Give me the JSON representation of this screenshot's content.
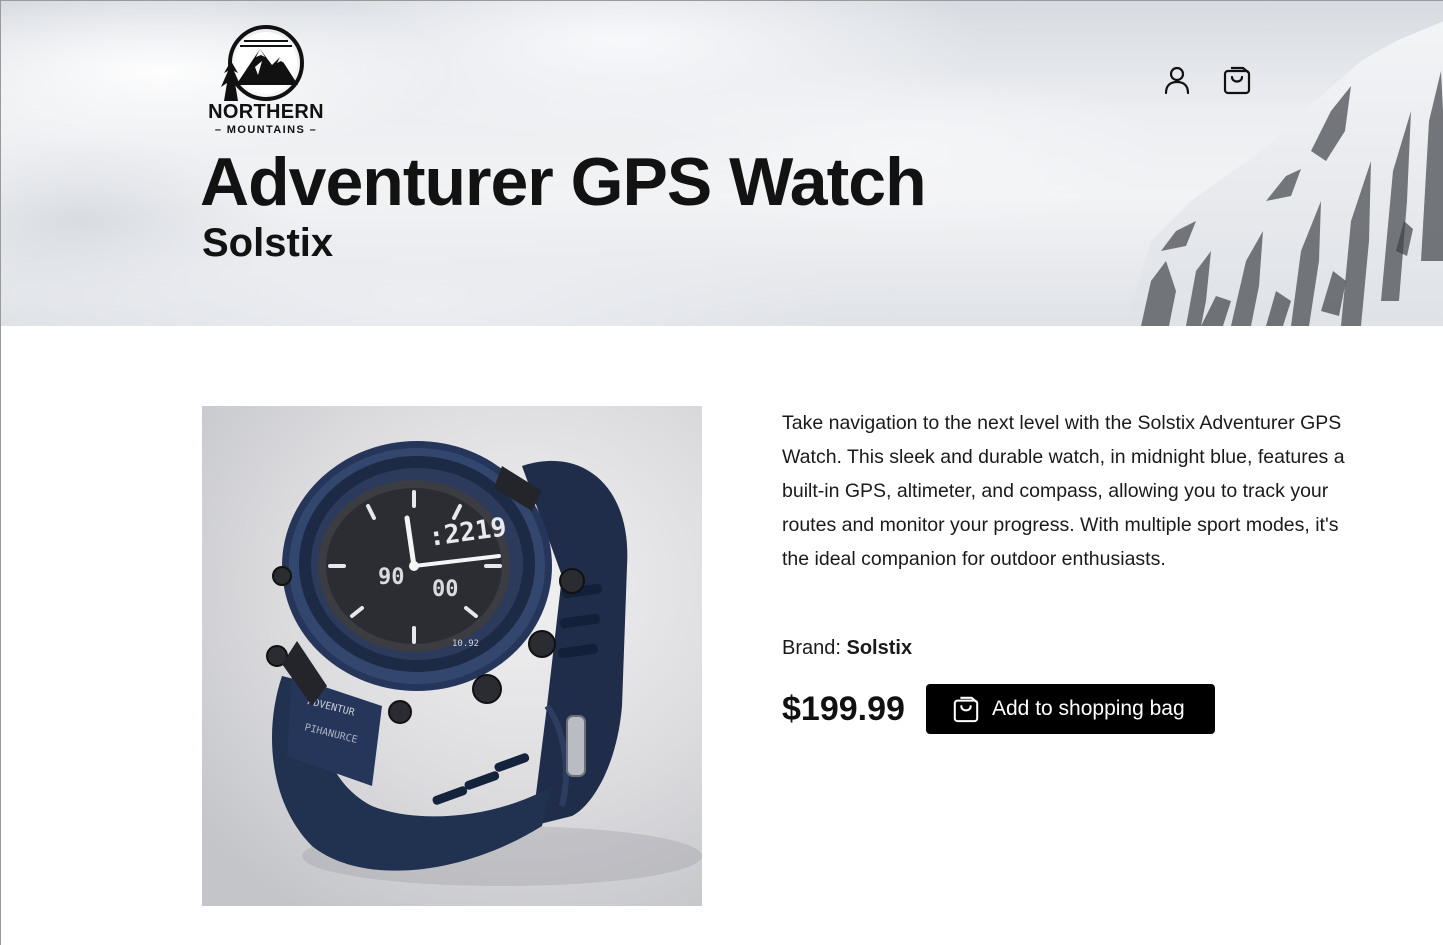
{
  "header": {
    "brand_line1": "NORTHERN",
    "brand_line2": "MOUNTAINS",
    "account_icon": "user-icon",
    "bag_icon": "shopping-bag-icon"
  },
  "product": {
    "title": "Adventurer GPS Watch",
    "maker": "Solstix",
    "description": "Take navigation to the next level with the Solstix Adventurer GPS Watch. This sleek and durable watch, in midnight blue, features a built-in GPS, altimeter, and compass, allowing you to track your routes and monitor your progress. With multiple sport modes, it's the ideal companion for outdoor enthusiasts.",
    "brand_label": "Brand:",
    "brand_value": "Solstix",
    "price": "$199.99",
    "add_button_label": "Add to shopping bag",
    "image_subject": "watch-image",
    "watch_face_time": ":2219",
    "watch_strap_text_1": "ADVENTUR",
    "watch_strap_text_2": "PIHANURCE",
    "watch_dial_text_1": "90",
    "watch_dial_text_2": "00",
    "watch_bezel_text": "10.92"
  },
  "colors": {
    "button_bg": "#000000",
    "button_text": "#ffffff",
    "watch_blue": "#1f2d4a"
  }
}
